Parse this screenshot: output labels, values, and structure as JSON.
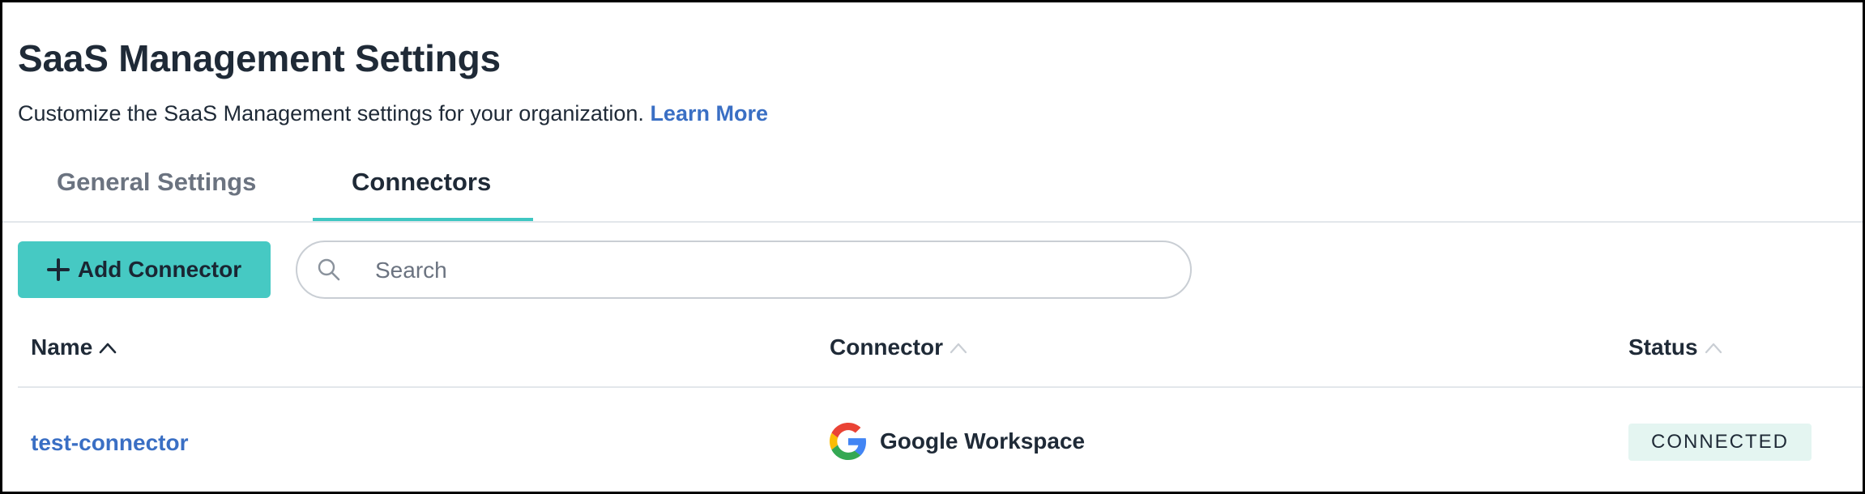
{
  "page": {
    "title": "SaaS Management Settings",
    "subtitle": "Customize the SaaS Management settings for your organization.",
    "learn_more": "Learn More"
  },
  "tabs": [
    {
      "label": "General Settings",
      "active": false
    },
    {
      "label": "Connectors",
      "active": true
    }
  ],
  "toolbar": {
    "add_label": "Add Connector",
    "search_placeholder": "Search"
  },
  "table": {
    "columns": [
      {
        "label": "Name",
        "sort": "ascending-active"
      },
      {
        "label": "Connector",
        "sort": "inactive"
      },
      {
        "label": "Status",
        "sort": "inactive"
      }
    ],
    "rows": [
      {
        "name": "test-connector",
        "connector": "Google Workspace",
        "connector_icon": "google-g-logo",
        "status": "CONNECTED"
      }
    ]
  },
  "colors": {
    "accent": "#46c9c3",
    "link": "#3a6fc4",
    "status_bg": "#e4f5f1"
  }
}
